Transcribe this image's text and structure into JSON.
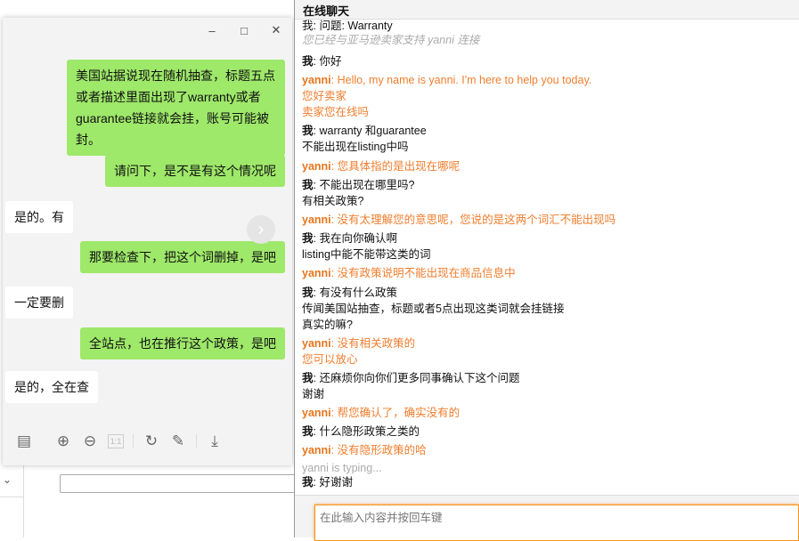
{
  "viewer": {
    "bubbles": [
      {
        "side": "right",
        "text": "美国站据说现在随机抽查，标题五点或者描述里面出现了warranty或者guarantee链接就会挂，账号可能被封。"
      },
      {
        "side": "right",
        "text": "请问下，是不是有这个情况呢"
      },
      {
        "side": "left",
        "text": "是的。有"
      },
      {
        "side": "right",
        "text": "那要检查下，把这个词删掉，是吧"
      },
      {
        "side": "left",
        "text": "一定要删"
      },
      {
        "side": "right",
        "text": "全站点，也在推行这个政策，是吧"
      },
      {
        "side": "left",
        "text": "是的，全在查"
      }
    ],
    "tools": {
      "ratio_label": "1:1"
    }
  },
  "chat": {
    "title": "在线聊天",
    "input_placeholder": "在此输入内容并按回车键",
    "typing": "yanni is typing...",
    "partial_top": "我: 问题: Warranty",
    "system": "您已经与亚马逊卖家支持 yanni 连接",
    "messages": [
      {
        "who": "我",
        "lines": [
          "你好"
        ]
      },
      {
        "who": "yanni",
        "lines": [
          "Hello, my name is yanni. I'm here to help you today.",
          "您好卖家",
          "卖家您在线吗"
        ]
      },
      {
        "who": "我",
        "lines": [
          "warranty 和guarantee",
          "不能出现在listing中吗"
        ]
      },
      {
        "who": "yanni",
        "lines": [
          "您具体指的是出现在哪呢"
        ]
      },
      {
        "who": "我",
        "lines": [
          "不能出现在哪里吗?",
          "有相关政策?"
        ]
      },
      {
        "who": "yanni",
        "lines": [
          "没有太理解您的意思呢，您说的是这两个词汇不能出现吗"
        ]
      },
      {
        "who": "我",
        "lines": [
          "我在向你确认啊",
          "listing中能不能带这类的词"
        ]
      },
      {
        "who": "yanni",
        "lines": [
          "没有政策说明不能出现在商品信息中"
        ]
      },
      {
        "who": "我",
        "lines": [
          "有没有什么政策",
          "传闻美国站抽查，标题或者5点出现这类词就会挂链接",
          "真实的嘛?"
        ]
      },
      {
        "who": "yanni",
        "lines": [
          "没有相关政策的",
          "您可以放心"
        ]
      },
      {
        "who": "我",
        "lines": [
          "还麻烦你向你们更多同事确认下这个问题",
          "谢谢"
        ]
      },
      {
        "who": "yanni",
        "lines": [
          "帮您确认了，确实没有的"
        ]
      },
      {
        "who": "我",
        "lines": [
          "什么隐形政策之类的"
        ]
      },
      {
        "who": "yanni",
        "lines": [
          "没有隐形政策的哈"
        ]
      }
    ],
    "last": {
      "who": "我",
      "lines": [
        "好谢谢"
      ]
    }
  },
  "colors": {
    "agent": "#f07e2e",
    "bubble_green": "#9ee86a",
    "input_border": "#f7941d"
  }
}
